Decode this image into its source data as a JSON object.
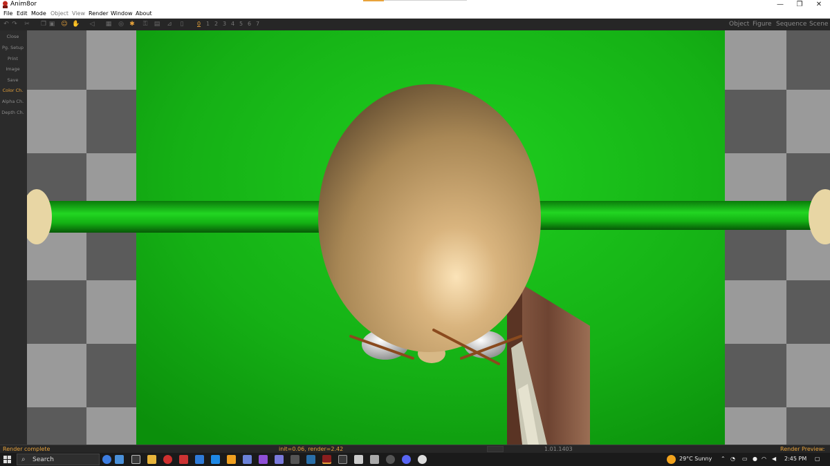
{
  "window": {
    "title": "Anim8or",
    "controls": {
      "minimize": "—",
      "restore": "❐",
      "close": "✕"
    }
  },
  "menu": [
    "File",
    "Edit",
    "Mode",
    "Object",
    "View",
    "Render",
    "Window",
    "About"
  ],
  "toolbar": {
    "frames": [
      "0",
      "1",
      "2",
      "3",
      "4",
      "5",
      "6",
      "7"
    ],
    "active_frame": "0",
    "modes": [
      "Object",
      "Figure",
      "Sequence",
      "Scene"
    ]
  },
  "left_panel": {
    "buttons": [
      "Close",
      "Pg. Setup",
      "Print",
      "Image",
      "Save",
      "Color Ch.",
      "Alpha Ch.",
      "Depth Ch."
    ],
    "active": "Color Ch."
  },
  "status": {
    "left": "Render complete",
    "middle": "init=0.06, render=2.42",
    "version": "1.01.1403",
    "right": "Render Preview:"
  },
  "taskbar": {
    "search_label": "Search",
    "weather": "29°C  Sunny",
    "time": "2:45 PM"
  },
  "colors": {
    "accent": "#e8a33b",
    "background_green": "#17b817",
    "egg": "#c9a46e"
  }
}
